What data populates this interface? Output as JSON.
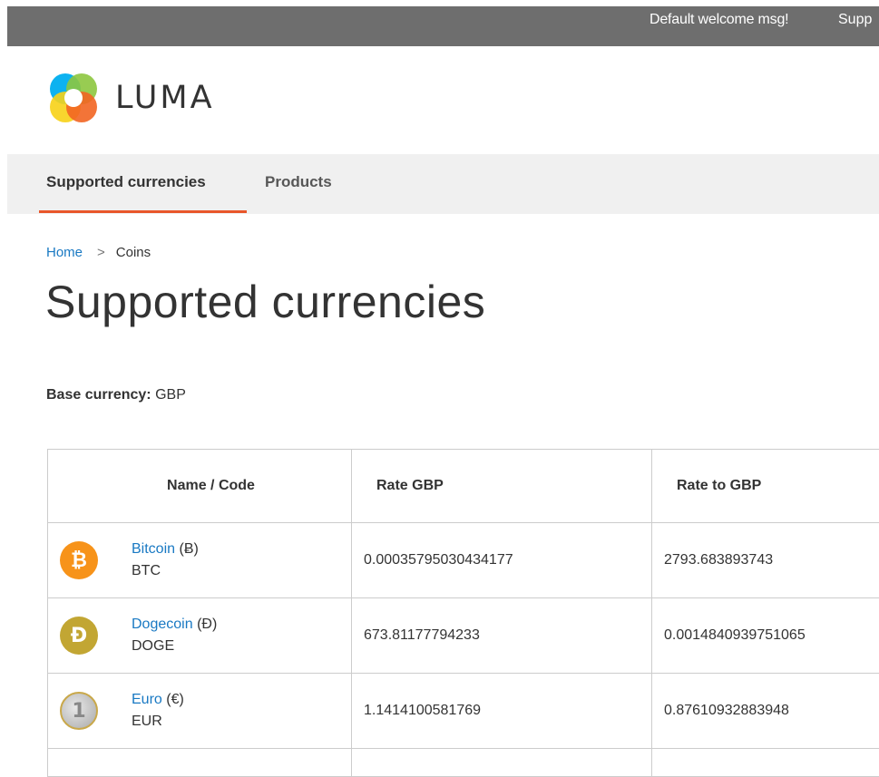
{
  "header": {
    "welcome": "Default welcome msg!",
    "support_fragment": "Supp"
  },
  "brand": {
    "name": "LUMA",
    "colors": [
      "#00aeef",
      "#f26522",
      "#8dc63f",
      "#f7d117"
    ]
  },
  "nav": {
    "items": [
      {
        "label": "Supported currencies"
      },
      {
        "label": "Products"
      }
    ],
    "active_color": "#e8562a"
  },
  "breadcrumb": {
    "home": "Home",
    "separator": ">",
    "current": "Coins"
  },
  "page": {
    "title": "Supported currencies",
    "base_label": "Base currency:",
    "base_value": "GBP"
  },
  "table": {
    "headers": [
      "Name / Code",
      "Rate GBP",
      "Rate to GBP"
    ],
    "rows": [
      {
        "name": "Bitcoin",
        "symbol": "(Ƀ)",
        "code": "BTC",
        "icon": "bitcoin-icon",
        "icon_glyph": "₿",
        "icon_color": "#f7931a",
        "rate": "0.00035795030434177",
        "rate_to": "2793.683893743"
      },
      {
        "name": "Dogecoin",
        "symbol": "(Ð)",
        "code": "DOGE",
        "icon": "dogecoin-icon",
        "icon_glyph": "Ð",
        "icon_color": "#c2a633",
        "rate": "673.81177794233",
        "rate_to": "0.0014840939751065"
      },
      {
        "name": "Euro",
        "symbol": "(€)",
        "code": "EUR",
        "icon": "euro-coin-icon",
        "icon_glyph": "1",
        "icon_color": "#b8b8b8",
        "rate": "1.1414100581769",
        "rate_to": "0.87610932883948"
      }
    ]
  }
}
